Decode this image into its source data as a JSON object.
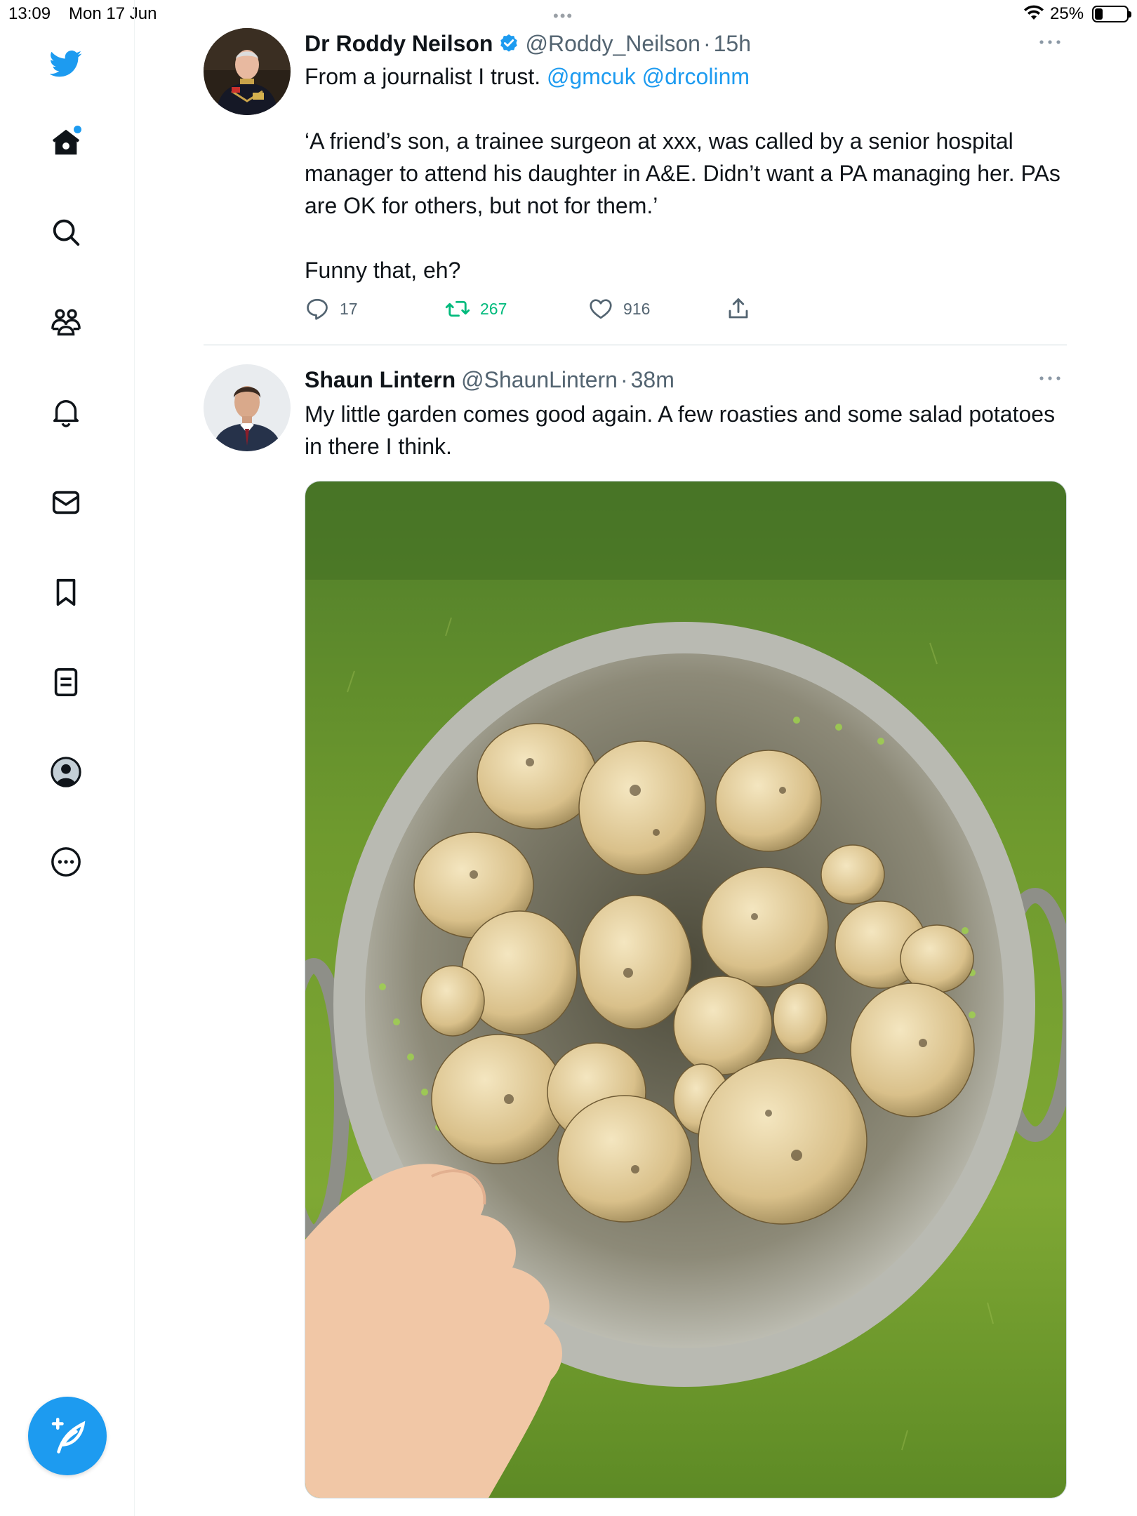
{
  "status_bar": {
    "time": "13:09",
    "date": "Mon 17 Jun",
    "battery": "25%"
  },
  "sidebar": {
    "items": [
      {
        "icon": "twitter-logo-icon"
      },
      {
        "icon": "home-icon",
        "notification_dot": true
      },
      {
        "icon": "search-icon"
      },
      {
        "icon": "communities-icon"
      },
      {
        "icon": "notifications-bell-icon"
      },
      {
        "icon": "messages-envelope-icon"
      },
      {
        "icon": "bookmark-icon"
      },
      {
        "icon": "lists-icon"
      },
      {
        "icon": "profile-icon"
      },
      {
        "icon": "more-circle-icon"
      }
    ],
    "compose_icon": "compose-feather-icon"
  },
  "colors": {
    "accent": "#1d9bf0",
    "retweeted": "#00ba7c",
    "secondary_text": "#536471"
  },
  "tweets": [
    {
      "name": "Dr Roddy Neilson",
      "verified": true,
      "handle": "@Roddy_Neilson",
      "time": "15h",
      "text_intro": "From a journalist I trust. ",
      "mention_1": "@gmcuk",
      "mention_2": "@drcolinm",
      "quote": "‘A friend’s son, a trainee surgeon at xxx, was called by a senior hospital manager to attend his daughter in A&E. Didn’t want a PA managing her. PAs are OK for others, but not for them.’",
      "closing": "Funny that, eh?",
      "replies": "17",
      "retweets": "267",
      "likes": "916"
    },
    {
      "name": "Shaun Lintern",
      "verified": false,
      "handle": "@ShaunLintern",
      "time": "38m",
      "text": "My little garden comes good again. A few roasties and some salad potatoes in there I think.",
      "image": "photo of freshly dug potatoes in a metal colander held over grass"
    }
  ],
  "separator": "·"
}
